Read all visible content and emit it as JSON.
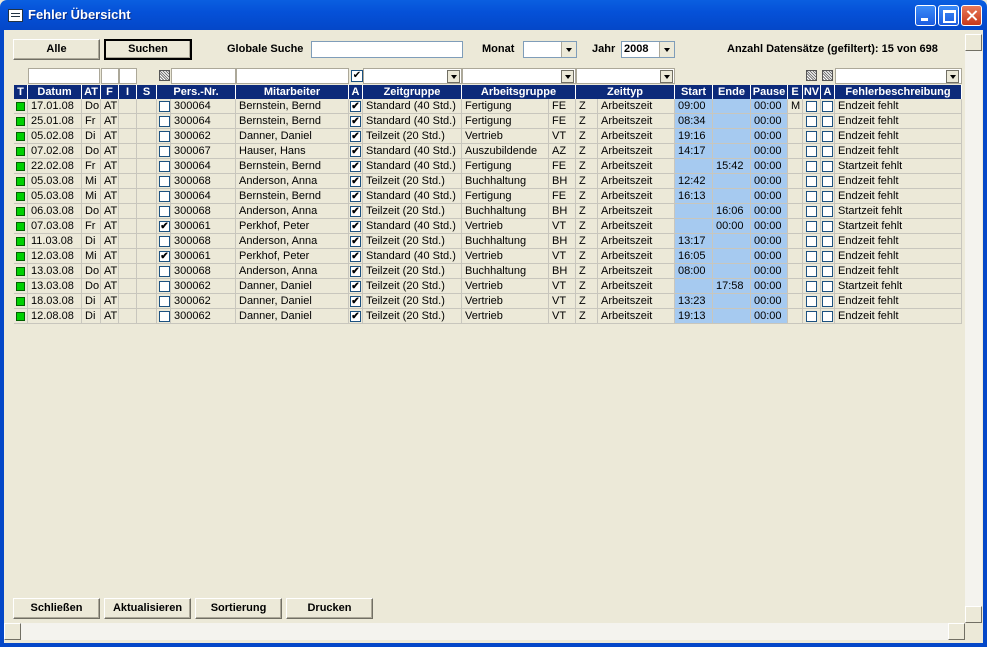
{
  "window": {
    "title": "Fehler Übersicht"
  },
  "toolbar": {
    "alle": "Alle",
    "suchen": "Suchen",
    "global_label": "Globale Suche",
    "global_value": "",
    "monat_label": "Monat",
    "monat_value": "",
    "jahr_label": "Jahr",
    "jahr_value": "2008",
    "count_text": "Anzahl Datensätze (gefiltert): 15 von 698"
  },
  "columns": [
    "T",
    "Datum",
    "AT",
    "F",
    "I",
    "S",
    "Pers.-Nr.",
    "Mitarbeiter",
    "A",
    "Zeitgruppe",
    "Arbeitsgruppe",
    "Zeittyp",
    "Start",
    "Ende",
    "Pause",
    "E",
    "NV",
    "A",
    "Fehlerbeschreibung"
  ],
  "rows": [
    {
      "datum": "17.01.08",
      "tag": "Do",
      "at": "AT",
      "s": false,
      "pers": "300064",
      "name": "Bernstein, Bernd",
      "a": true,
      "zg": "Standard (40 Std.)",
      "ag": "Fertigung",
      "agk": "FE",
      "zk": "Z",
      "zt": "Arbeitszeit",
      "start": "09:00",
      "ende": "",
      "pause": "00:00",
      "e": "M",
      "fehler": "Endzeit fehlt"
    },
    {
      "datum": "25.01.08",
      "tag": "Fr",
      "at": "AT",
      "s": false,
      "pers": "300064",
      "name": "Bernstein, Bernd",
      "a": true,
      "zg": "Standard (40 Std.)",
      "ag": "Fertigung",
      "agk": "FE",
      "zk": "Z",
      "zt": "Arbeitszeit",
      "start": "08:34",
      "ende": "",
      "pause": "00:00",
      "e": "",
      "fehler": "Endzeit fehlt"
    },
    {
      "datum": "05.02.08",
      "tag": "Di",
      "at": "AT",
      "s": false,
      "pers": "300062",
      "name": "Danner, Daniel",
      "a": true,
      "zg": "Teilzeit (20 Std.)",
      "ag": "Vertrieb",
      "agk": "VT",
      "zk": "Z",
      "zt": "Arbeitszeit",
      "start": "19:16",
      "ende": "",
      "pause": "00:00",
      "e": "",
      "fehler": "Endzeit fehlt"
    },
    {
      "datum": "07.02.08",
      "tag": "Do",
      "at": "AT",
      "s": false,
      "pers": "300067",
      "name": "Hauser, Hans",
      "a": true,
      "zg": "Standard (40 Std.)",
      "ag": "Auszubildende",
      "agk": "AZ",
      "zk": "Z",
      "zt": "Arbeitszeit",
      "start": "14:17",
      "ende": "",
      "pause": "00:00",
      "e": "",
      "fehler": "Endzeit fehlt"
    },
    {
      "datum": "22.02.08",
      "tag": "Fr",
      "at": "AT",
      "s": false,
      "pers": "300064",
      "name": "Bernstein, Bernd",
      "a": true,
      "zg": "Standard (40 Std.)",
      "ag": "Fertigung",
      "agk": "FE",
      "zk": "Z",
      "zt": "Arbeitszeit",
      "start": "",
      "ende": "15:42",
      "pause": "00:00",
      "e": "",
      "fehler": "Startzeit fehlt"
    },
    {
      "datum": "05.03.08",
      "tag": "Mi",
      "at": "AT",
      "s": false,
      "pers": "300068",
      "name": "Anderson, Anna",
      "a": true,
      "zg": "Teilzeit (20 Std.)",
      "ag": "Buchhaltung",
      "agk": "BH",
      "zk": "Z",
      "zt": "Arbeitszeit",
      "start": "12:42",
      "ende": "",
      "pause": "00:00",
      "e": "",
      "fehler": "Endzeit fehlt"
    },
    {
      "datum": "05.03.08",
      "tag": "Mi",
      "at": "AT",
      "s": false,
      "pers": "300064",
      "name": "Bernstein, Bernd",
      "a": true,
      "zg": "Standard (40 Std.)",
      "ag": "Fertigung",
      "agk": "FE",
      "zk": "Z",
      "zt": "Arbeitszeit",
      "start": "16:13",
      "ende": "",
      "pause": "00:00",
      "e": "",
      "fehler": "Endzeit fehlt"
    },
    {
      "datum": "06.03.08",
      "tag": "Do",
      "at": "AT",
      "s": false,
      "pers": "300068",
      "name": "Anderson, Anna",
      "a": true,
      "zg": "Teilzeit (20 Std.)",
      "ag": "Buchhaltung",
      "agk": "BH",
      "zk": "Z",
      "zt": "Arbeitszeit",
      "start": "",
      "ende": "16:06",
      "pause": "00:00",
      "e": "",
      "fehler": "Startzeit fehlt"
    },
    {
      "datum": "07.03.08",
      "tag": "Fr",
      "at": "AT",
      "s": true,
      "pers": "300061",
      "name": "Perkhof, Peter",
      "a": true,
      "zg": "Standard (40 Std.)",
      "ag": "Vertrieb",
      "agk": "VT",
      "zk": "Z",
      "zt": "Arbeitszeit",
      "start": "",
      "ende": "00:00",
      "pause": "00:00",
      "e": "",
      "fehler": "Startzeit fehlt"
    },
    {
      "datum": "11.03.08",
      "tag": "Di",
      "at": "AT",
      "s": false,
      "pers": "300068",
      "name": "Anderson, Anna",
      "a": true,
      "zg": "Teilzeit (20 Std.)",
      "ag": "Buchhaltung",
      "agk": "BH",
      "zk": "Z",
      "zt": "Arbeitszeit",
      "start": "13:17",
      "ende": "",
      "pause": "00:00",
      "e": "",
      "fehler": "Endzeit fehlt"
    },
    {
      "datum": "12.03.08",
      "tag": "Mi",
      "at": "AT",
      "s": true,
      "pers": "300061",
      "name": "Perkhof, Peter",
      "a": true,
      "zg": "Standard (40 Std.)",
      "ag": "Vertrieb",
      "agk": "VT",
      "zk": "Z",
      "zt": "Arbeitszeit",
      "start": "16:05",
      "ende": "",
      "pause": "00:00",
      "e": "",
      "fehler": "Endzeit fehlt"
    },
    {
      "datum": "13.03.08",
      "tag": "Do",
      "at": "AT",
      "s": false,
      "pers": "300068",
      "name": "Anderson, Anna",
      "a": true,
      "zg": "Teilzeit (20 Std.)",
      "ag": "Buchhaltung",
      "agk": "BH",
      "zk": "Z",
      "zt": "Arbeitszeit",
      "start": "08:00",
      "ende": "",
      "pause": "00:00",
      "e": "",
      "fehler": "Endzeit fehlt"
    },
    {
      "datum": "13.03.08",
      "tag": "Do",
      "at": "AT",
      "s": false,
      "pers": "300062",
      "name": "Danner, Daniel",
      "a": true,
      "zg": "Teilzeit (20 Std.)",
      "ag": "Vertrieb",
      "agk": "VT",
      "zk": "Z",
      "zt": "Arbeitszeit",
      "start": "",
      "ende": "17:58",
      "pause": "00:00",
      "e": "",
      "fehler": "Startzeit fehlt"
    },
    {
      "datum": "18.03.08",
      "tag": "Di",
      "at": "AT",
      "s": false,
      "pers": "300062",
      "name": "Danner, Daniel",
      "a": true,
      "zg": "Teilzeit (20 Std.)",
      "ag": "Vertrieb",
      "agk": "VT",
      "zk": "Z",
      "zt": "Arbeitszeit",
      "start": "13:23",
      "ende": "",
      "pause": "00:00",
      "e": "",
      "fehler": "Endzeit fehlt"
    },
    {
      "datum": "12.08.08",
      "tag": "Di",
      "at": "AT",
      "s": false,
      "pers": "300062",
      "name": "Danner, Daniel",
      "a": true,
      "zg": "Teilzeit (20 Std.)",
      "ag": "Vertrieb",
      "agk": "VT",
      "zk": "Z",
      "zt": "Arbeitszeit",
      "start": "19:13",
      "ende": "",
      "pause": "00:00",
      "e": "",
      "fehler": "Endzeit fehlt"
    }
  ],
  "footer": {
    "schliessen": "Schließen",
    "aktualisieren": "Aktualisieren",
    "sortierung": "Sortierung",
    "drucken": "Drucken"
  },
  "checkmark": "✔",
  "colors": {
    "titlebar": "#0447c8",
    "header": "#0c2a7a",
    "time_cell": "#a6caf0",
    "status": "#00d000"
  }
}
